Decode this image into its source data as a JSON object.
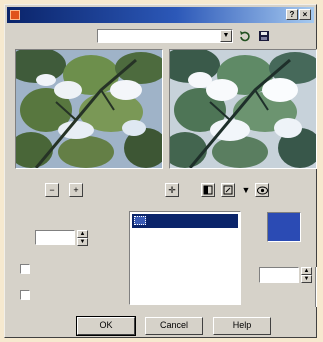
{
  "window": {
    "title": "",
    "controls": {
      "help": "?",
      "close": "×"
    }
  },
  "load": {
    "label": "",
    "preset_value": "",
    "browse_label": "..."
  },
  "zoom": {
    "value": ""
  },
  "left_panel": {
    "size_label": "",
    "size_value": "",
    "option1_label": "",
    "option2_label": ""
  },
  "list": {
    "items": [
      ""
    ]
  },
  "color": {
    "label": "",
    "value": "",
    "swatch_hex": "#2b4bb4",
    "button_label": ""
  },
  "buttons": {
    "ok": "OK",
    "cancel": "Cancel",
    "help": "Help"
  }
}
